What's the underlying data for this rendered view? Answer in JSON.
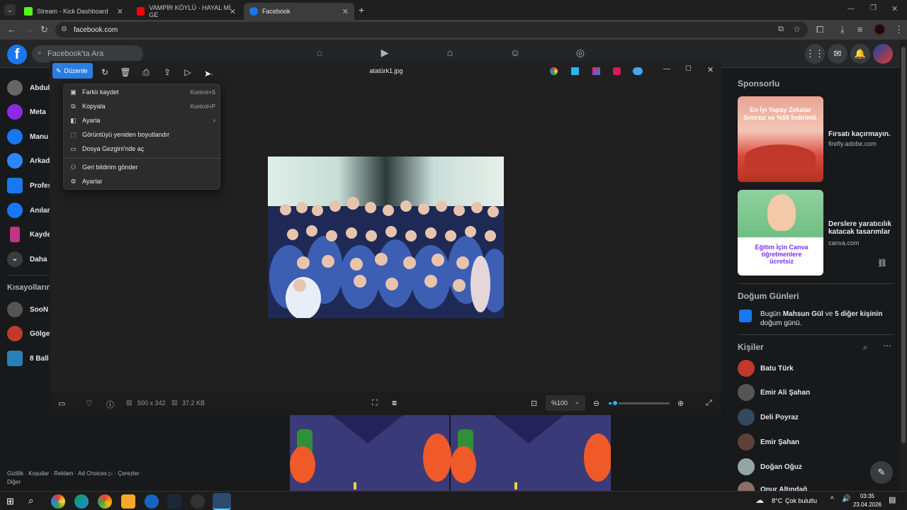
{
  "browser": {
    "tabs": [
      {
        "title": "Stream - Kick Dashboard",
        "favicon_color": "#53fc18"
      },
      {
        "title": "VAMPİR KÖYLÜ - HAYAL Mİ GE",
        "favicon_color": "#ff0000"
      },
      {
        "title": "Facebook",
        "favicon_color": "#1877f2"
      }
    ],
    "url": "facebook.com"
  },
  "facebook": {
    "logo": "f",
    "search_placeholder": "Facebook'ta Ara",
    "sidebar": {
      "items": [
        {
          "label": "Abdul",
          "color": "#666"
        },
        {
          "label": "Meta",
          "color": "#8a2be2"
        },
        {
          "label": "Manu",
          "color": "#1877f2"
        },
        {
          "label": "Arkad",
          "color": "#2d88ff"
        },
        {
          "label": "Profes",
          "color": "#1877f2"
        },
        {
          "label": "Anılar",
          "color": "#1877f2"
        },
        {
          "label": "Kayde",
          "color": "#c13584"
        },
        {
          "label": "Daha",
          "color": "#3a3b3c"
        }
      ],
      "shortcuts_title": "Kısayolların",
      "shortcuts": [
        {
          "label": "SooN",
          "color": "#555"
        },
        {
          "label": "Gölge",
          "color": "#c0392b"
        },
        {
          "label": "8 Ball",
          "color": "#2980b9"
        }
      ],
      "footer": "Gizlilik · Koşullar · Reklam · Ad Choices ▷ · Çerezler ·",
      "footer2": "Diğer"
    },
    "right": {
      "sponsored_title": "Sponsorlu",
      "ads": [
        {
          "title": "Fırsatı kaçırmayın.",
          "domain": "firefly.adobe.com",
          "img_text": "En İyi Yapay Zekalar Sınırsız ve %50 İndirimli."
        },
        {
          "title": "Derslere yaratıcılık katacak tasarımlar",
          "domain": "canva.com",
          "img_text": "Eğitim İçin Canva öğretmenlere ücretsiz"
        }
      ],
      "birthdays_title": "Doğum Günleri",
      "birthday_text_pre": "Bugün ",
      "birthday_name": "Mahsun Gül",
      "birthday_mid": " ve ",
      "birthday_others": "5 diğer kişinin",
      "birthday_post": "doğum günü.",
      "contacts_title": "Kişiler",
      "contacts": [
        {
          "name": "Batu Türk",
          "color": "#c0392b"
        },
        {
          "name": "Emir Ali Şahan",
          "color": "#555"
        },
        {
          "name": "Deli Poyraz",
          "color": "#34495e"
        },
        {
          "name": "Emir Şahan",
          "color": "#5d4037"
        },
        {
          "name": "Doğan Oğuz",
          "color": "#95a5a6"
        },
        {
          "name": "Onur Altındağ",
          "color": "#8d6e63"
        }
      ]
    }
  },
  "viewer": {
    "edit_label": "Düzenle",
    "filename": "atatürk1.jpg",
    "dimensions": "500 x 342",
    "filesize": "37.2 KB",
    "zoom": "%100",
    "zoom_level": 0.1,
    "menu": [
      {
        "label": "Farklı kaydet",
        "shortcut": "Kontrol+S",
        "icon": "save-icon"
      },
      {
        "label": "Kopyala",
        "shortcut": "Kontrol+P",
        "icon": "copy-icon"
      },
      {
        "label": "Ayarla",
        "shortcut": "",
        "icon": "adjust-icon",
        "submenu": true
      },
      {
        "label": "Görüntüyü yeniden boyutlandır",
        "shortcut": "",
        "icon": "resize-icon"
      },
      {
        "label": "Dosya Gezgini'nde aç",
        "shortcut": "",
        "icon": "folder-icon"
      },
      {
        "label": "Geri bildirim gönder",
        "shortcut": "",
        "icon": "feedback-icon"
      },
      {
        "label": "Ayarlar",
        "shortcut": "",
        "icon": "gear-icon"
      }
    ]
  },
  "taskbar": {
    "weather": "8°C",
    "weather_text": "Çok bulutlu",
    "time": "03:35",
    "date": "23.04.2026"
  }
}
